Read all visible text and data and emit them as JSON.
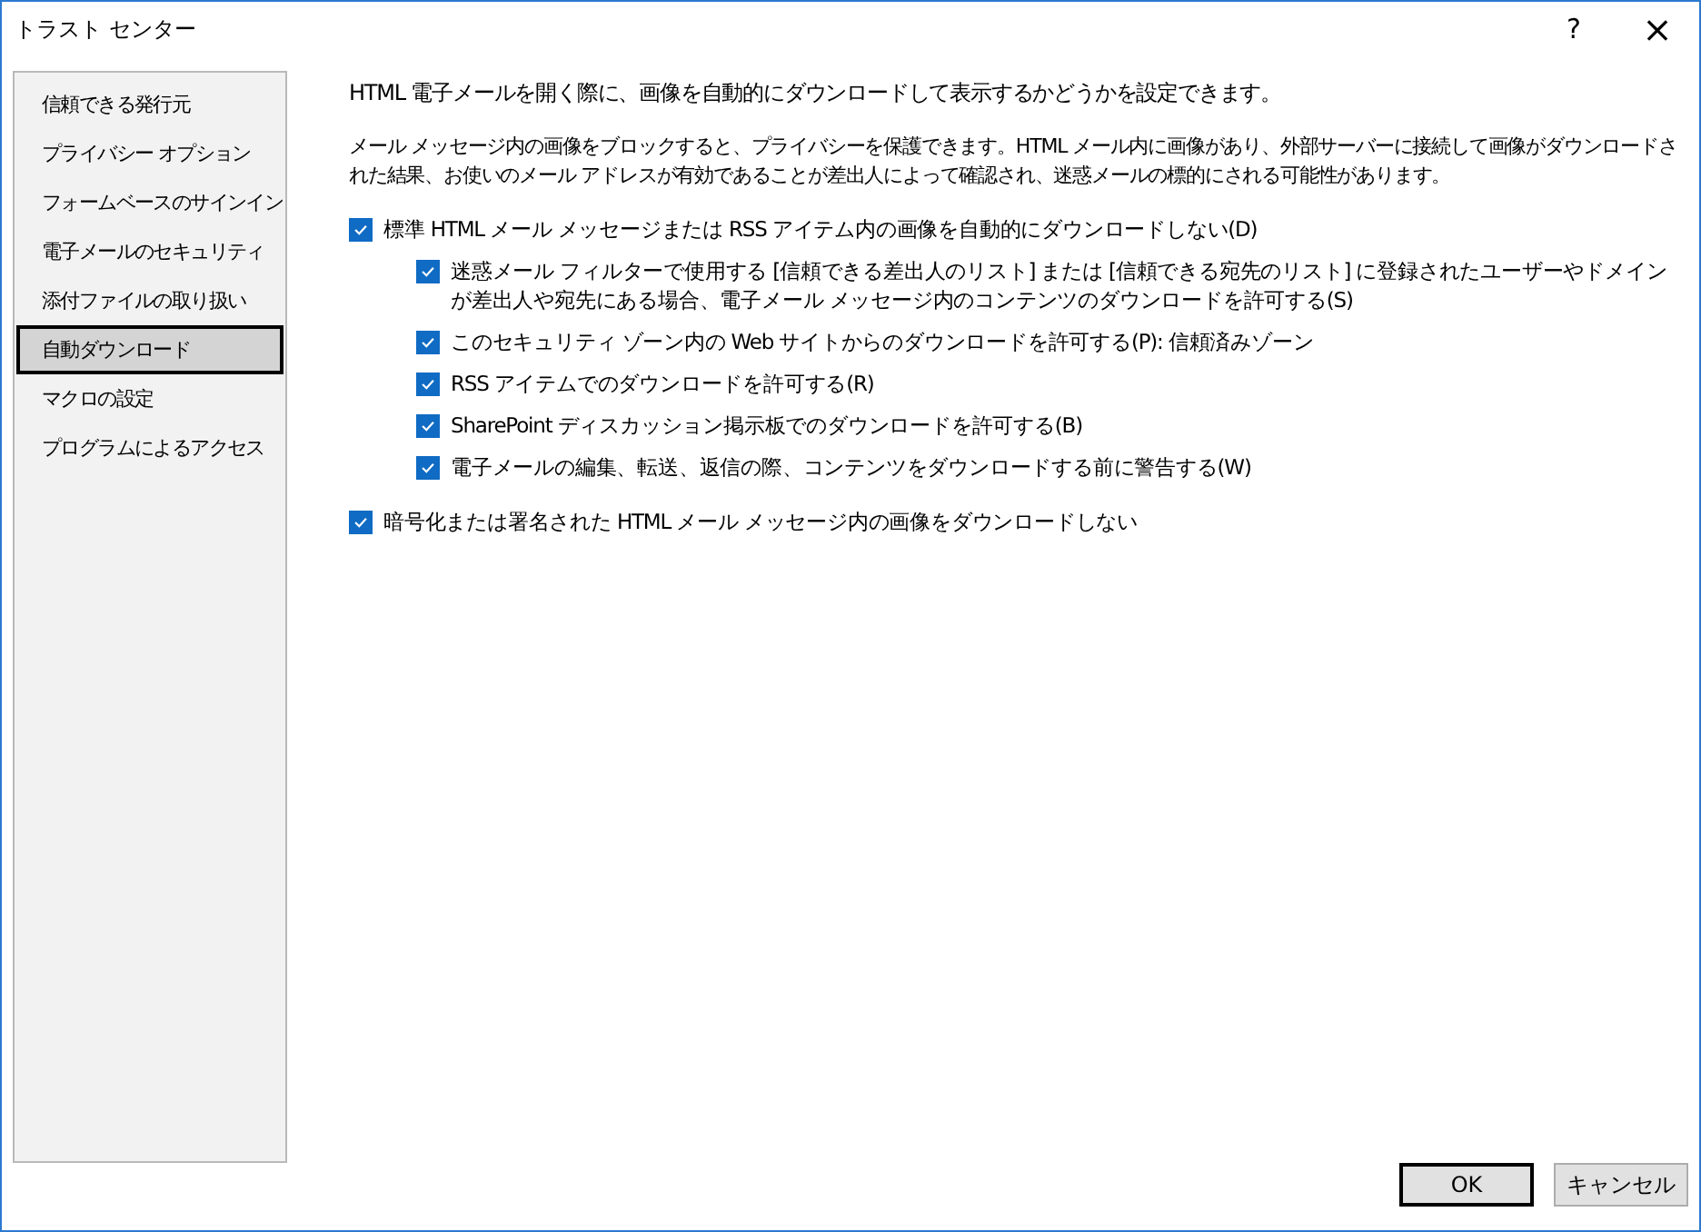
{
  "window": {
    "title": "トラスト センター",
    "help": "?",
    "close": "×"
  },
  "sidebar": {
    "items": [
      {
        "label": "信頼できる発行元",
        "selected": false
      },
      {
        "label": "プライバシー オプション",
        "selected": false
      },
      {
        "label": "フォームベースのサインイン",
        "selected": false
      },
      {
        "label": "電子メールのセキュリティ",
        "selected": false
      },
      {
        "label": "添付ファイルの取り扱い",
        "selected": false
      },
      {
        "label": "自動ダウンロード",
        "selected": true
      },
      {
        "label": "マクロの設定",
        "selected": false
      },
      {
        "label": "プログラムによるアクセス",
        "selected": false
      }
    ]
  },
  "intro": "HTML 電子メールを開く際に、画像を自動的にダウンロードして表示するかどうかを設定できます。",
  "description": "メール メッセージ内の画像をブロックすると、プライバシーを保護できます。HTML メール内に画像があり、外部サーバーに接続して画像がダウンロードされた結果、お使いのメール アドレスが有効であることが差出人によって確認され、迷惑メールの標的にされる可能性があります。",
  "options": [
    {
      "label": "標準 HTML メール メッセージまたは RSS アイテム内の画像を自動的にダウンロードしない(D)",
      "checked": true,
      "children": [
        {
          "label": "迷惑メール フィルターで使用する [信頼できる差出人のリスト] または [信頼できる宛先のリスト] に登録されたユーザーやドメインが差出人や宛先にある場合、電子メール メッセージ内のコンテンツのダウンロードを許可する(S)",
          "checked": true
        },
        {
          "label": "このセキュリティ ゾーン内の Web サイトからのダウンロードを許可する(P): 信頼済みゾーン",
          "checked": true
        },
        {
          "label": "RSS アイテムでのダウンロードを許可する(R)",
          "checked": true
        },
        {
          "label": "SharePoint ディスカッション掲示板でのダウンロードを許可する(B)",
          "checked": true
        },
        {
          "label": "電子メールの編集、転送、返信の際、コンテンツをダウンロードする前に警告する(W)",
          "checked": true
        }
      ]
    },
    {
      "label": "暗号化または署名された HTML メール メッセージ内の画像をダウンロードしない",
      "checked": true
    }
  ],
  "buttons": [
    {
      "label": "OK",
      "default": true
    },
    {
      "label": "キャンセル",
      "default": false
    }
  ]
}
